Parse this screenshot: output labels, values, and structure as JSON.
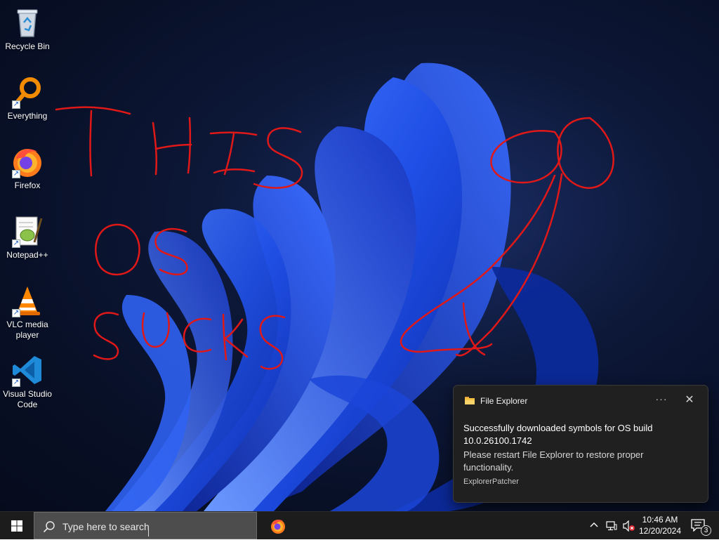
{
  "desktop": {
    "icons": [
      {
        "label": "Recycle Bin",
        "icon": "recycle-bin-icon"
      },
      {
        "label": "Everything",
        "icon": "everything-search-icon"
      },
      {
        "label": "Firefox",
        "icon": "firefox-icon"
      },
      {
        "label": "Notepad++",
        "icon": "notepad-plus-plus-icon"
      },
      {
        "label": "VLC media player",
        "icon": "vlc-icon"
      },
      {
        "label": "Visual Studio Code",
        "icon": "vscode-icon"
      }
    ],
    "wallpaper": "windows-11-bloom",
    "scribble_color": "#e01818"
  },
  "notification": {
    "app_name": "File Explorer",
    "more_label": "···",
    "close_label": "✕",
    "title": "Successfully downloaded symbols for OS build 10.0.26100.1742",
    "body": "Please restart File Explorer to restore proper functionality.",
    "attribution": "ExplorerPatcher"
  },
  "taskbar": {
    "search_placeholder": "Type here to search",
    "pinned_apps": [
      "firefox-icon"
    ],
    "tray": {
      "time": "10:46 AM",
      "date": "12/20/2024",
      "notification_count": "3",
      "icons": [
        "chevron-up-icon",
        "network-icon",
        "volume-muted-icon"
      ]
    }
  },
  "colors": {
    "taskbar_bg": "#1c1c1c",
    "toast_bg": "#202020",
    "wallpaper_accent": "#2458ff"
  }
}
